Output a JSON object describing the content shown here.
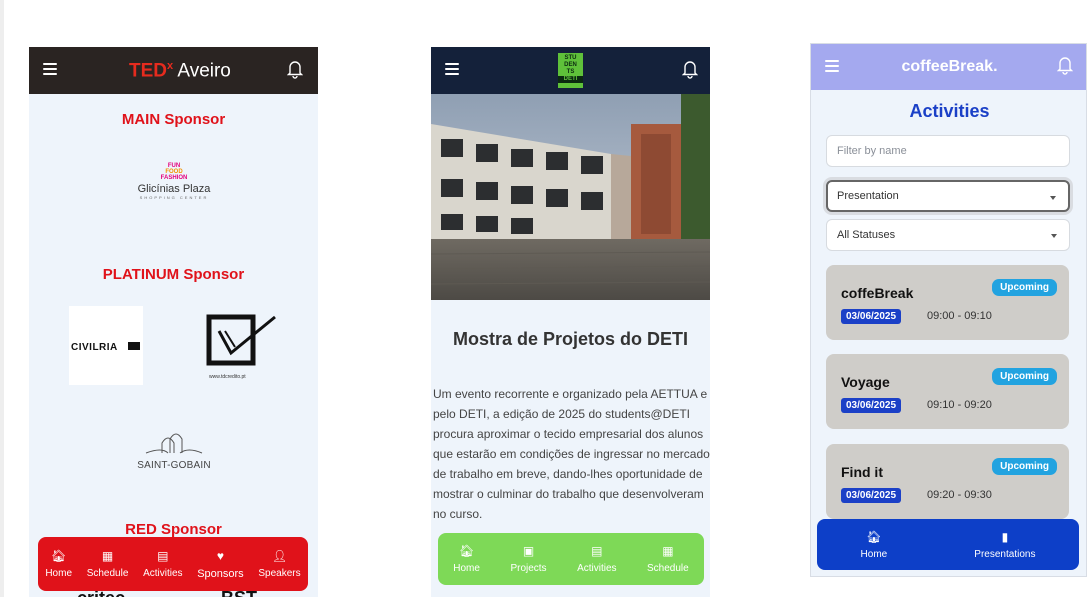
{
  "tedx_app": {
    "brand_ted": "TED",
    "brand_x": "x",
    "brand_city": "Aveiro",
    "sections": [
      "MAIN Sponsor",
      "PLATINUM Sponsor",
      "RED Sponsor"
    ],
    "sponsors": {
      "glicinias_tagline": [
        "FUN",
        "FOOD",
        "FASHION"
      ],
      "glicinias_name": "Glicínias Plaza",
      "glicinias_sub": "SHOPPING CENTER",
      "civilria": "CIVILRIA",
      "tdc_url": "www.tdcredito.pt",
      "saint_gobain": "SAINT-GOBAIN",
      "cut_left": "critec",
      "cut_right": "BST"
    },
    "nav": [
      "Home",
      "Schedule",
      "Activities",
      "Sponsors",
      "Speakers"
    ],
    "colors": {
      "accent": "#e0121a",
      "topbar": "#2a2422"
    }
  },
  "deti_app": {
    "brand_lines": [
      "STU",
      "DEN",
      "TS",
      "DETI"
    ],
    "title": "Mostra de Projetos do DETI",
    "description": "Um evento recorrente e organizado pela AETTUA e pelo DETI, a edição de 2025 do students@DETI procura aproximar o tecido empresarial dos alunos que estarão em condições de ingressar no mercado de trabalho em breve, dando-lhes oportunidade de mostrar o culminar do trabalho que desenvolveram no curso.",
    "nav": [
      "Home",
      "Projects",
      "Activities",
      "Schedule"
    ],
    "colors": {
      "accent": "#7ed957",
      "topbar": "#14213a"
    }
  },
  "coffee_app": {
    "brand": "coffeeBreak.",
    "title": "Activities",
    "filter_placeholder": "Filter by name",
    "type_select": "Presentation",
    "status_select": "All Statuses",
    "activities": [
      {
        "name": "coffeBreak",
        "status": "Upcoming",
        "date": "03/06/2025",
        "time": "09:00 - 09:10"
      },
      {
        "name": "Voyage",
        "status": "Upcoming",
        "date": "03/06/2025",
        "time": "09:10 - 09:20"
      },
      {
        "name": "Find it",
        "status": "Upcoming",
        "date": "03/06/2025",
        "time": "09:20 - 09:30"
      }
    ],
    "nav": [
      "Home",
      "Presentations"
    ],
    "colors": {
      "accent": "#0d3fc8",
      "topbar": "#a4a9ef",
      "badge": "#22a3e0"
    }
  }
}
